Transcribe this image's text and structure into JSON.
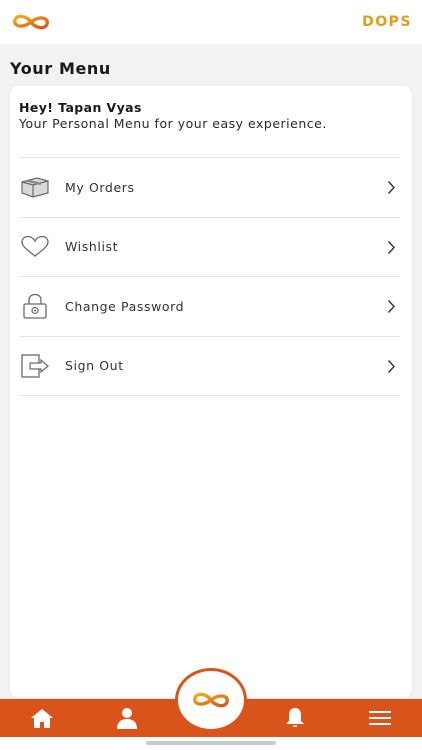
{
  "header": {
    "brand": "DOPS",
    "logo_icon": "infinity-logo-icon"
  },
  "page": {
    "title": "Your Menu"
  },
  "greeting": {
    "hello": "Hey! Tapan Vyas",
    "subtitle": "Your Personal Menu for your easy experience."
  },
  "menu": {
    "items": [
      {
        "label": "My Orders",
        "icon": "box-icon"
      },
      {
        "label": "Wishlist",
        "icon": "heart-icon"
      },
      {
        "label": "Change Password",
        "icon": "lock-icon"
      },
      {
        "label": "Sign Out",
        "icon": "sign-out-icon"
      }
    ]
  },
  "colors": {
    "accent": "#d8541b",
    "brand": "#e69a1a"
  }
}
